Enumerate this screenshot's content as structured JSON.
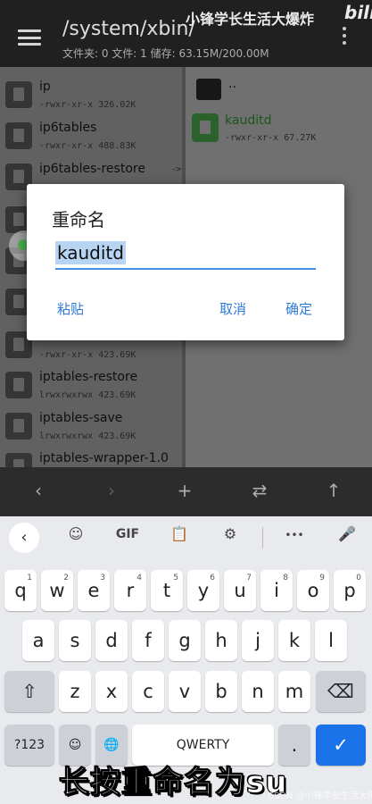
{
  "header": {
    "path": "/system/xbin/",
    "info": "文件夹: 0  文件: 1  储存: 63.15M/200.00M",
    "watermark": "小锋学长生活大爆炸",
    "brand": "bili"
  },
  "left_pane": {
    "files": [
      {
        "name": "ip",
        "meta": "-rwxr-xr-x 326.02K"
      },
      {
        "name": "ip6tables",
        "meta": "-rwxr-xr-x 488.83K"
      },
      {
        "name": "ip6tables-restore",
        "meta": ""
      },
      {
        "name": "",
        "meta": ""
      },
      {
        "name": "",
        "meta": ""
      },
      {
        "name": "",
        "meta": "-rwxr-xr-x 423.69K"
      },
      {
        "name": "iptables-restore",
        "meta": "lrwxrwxrwx 423.69K"
      },
      {
        "name": "iptables-save",
        "meta": "lrwxrwxrwx 423.69K"
      },
      {
        "name": "iptables-wrapper-1.0",
        "meta": ""
      }
    ],
    "arrow": "->"
  },
  "right_pane": {
    "parent": "..",
    "file": {
      "name": "kauditd",
      "meta": "-rwxr-xr-x 67.27K"
    }
  },
  "bottom_nav": {
    "back": "‹",
    "forward": "›",
    "add": "+",
    "swap": "⇄",
    "up": "↑"
  },
  "dialog": {
    "title": "重命名",
    "value": "kauditd",
    "paste": "粘贴",
    "cancel": "取消",
    "ok": "确定"
  },
  "keyboard": {
    "toolbar": {
      "back": "‹",
      "sticker": "☺",
      "gif": "GIF",
      "clipboard": "📋",
      "settings": "⚙",
      "more": "•••",
      "mic": "🎤"
    },
    "row1": [
      {
        "k": "q",
        "n": "1"
      },
      {
        "k": "w",
        "n": "2"
      },
      {
        "k": "e",
        "n": "3"
      },
      {
        "k": "r",
        "n": "4"
      },
      {
        "k": "t",
        "n": "5"
      },
      {
        "k": "y",
        "n": "6"
      },
      {
        "k": "u",
        "n": "7"
      },
      {
        "k": "i",
        "n": "8"
      },
      {
        "k": "o",
        "n": "9"
      },
      {
        "k": "p",
        "n": "0"
      }
    ],
    "row2": [
      "a",
      "s",
      "d",
      "f",
      "g",
      "h",
      "j",
      "k",
      "l"
    ],
    "row3": [
      "z",
      "x",
      "c",
      "v",
      "b",
      "n",
      "m"
    ],
    "shift": "⇧",
    "backspace": "⌫",
    "numbers": "?123",
    "emoji": "☺",
    "globe": "🌐",
    "space": "QWERTY",
    "period": ".",
    "enter": "✓"
  },
  "overlay": {
    "subtitle": "长按重命名为su",
    "credit": "CSDN @小锋学长生活大爆炸"
  }
}
